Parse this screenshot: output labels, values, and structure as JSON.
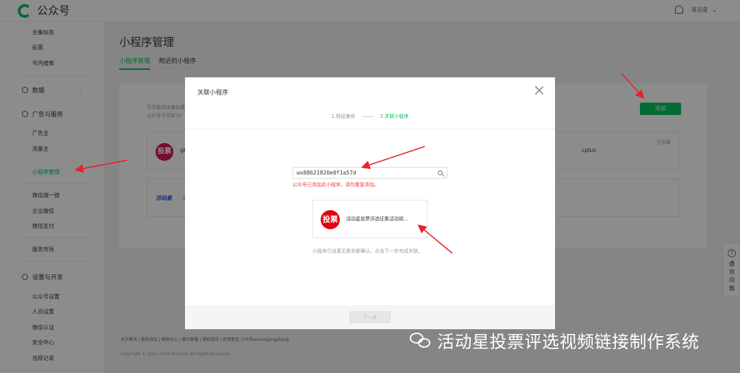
{
  "topbar": {
    "brand": "公众号",
    "user_name": "蒋吕星"
  },
  "sidebar": {
    "links_top": [
      "合集标签",
      "投票",
      "号内搜索"
    ],
    "sections": [
      {
        "label": "数据"
      },
      {
        "label": "广告与服务",
        "items": [
          "广告主",
          "流量主",
          "小程序管理",
          "微信搜一搜",
          "企业微信",
          "微信支付",
          "服务市场"
        ]
      },
      {
        "label": "设置与开发",
        "items": [
          "公众号设置",
          "人员设置",
          "微信认证",
          "安全中心",
          "违规记录"
        ]
      }
    ]
  },
  "main": {
    "title": "小程序管理",
    "tabs": [
      "小程序管理",
      "附近的小程序"
    ],
    "hint_line1": "可关联成快速创建",
    "hint_line2": "公众号可关联10",
    "add_button": "添加",
    "cards": [
      {
        "name": "gh",
        "logo_text": "投票",
        "right_text": "cplus",
        "status": "已关联"
      },
      {
        "name": "活",
        "logo_text": "活动星"
      }
    ]
  },
  "footer": {
    "links": "关于腾讯 | 服务协议 | 帮助中心 | 腾讯客服 | 侵权投诉 | 反馈意见 公众号weixingongzhong",
    "copyright": "Copyright © 2012-2023 Tencent. All Rights Reserved."
  },
  "help_widget": {
    "label": "遇到问题"
  },
  "dialog": {
    "title": "关联小程序",
    "step1": "1.验证身份",
    "step2": "2.关联小程序",
    "search_value": "wx88621820e0f1a57d",
    "error": "公众号已添加此小程序，请勿重复添加。",
    "result_logo": "投票",
    "result_name": "活动星投票评选征集活动视...",
    "note": "小程序已设置无需关联确认，点击下一步完成关联。",
    "next_button": "下一步"
  },
  "watermark": "活动星投票评选视频链接制作系统",
  "colors": {
    "accent": "#07c160",
    "error": "#e64340",
    "annotation": "#e8202a"
  }
}
